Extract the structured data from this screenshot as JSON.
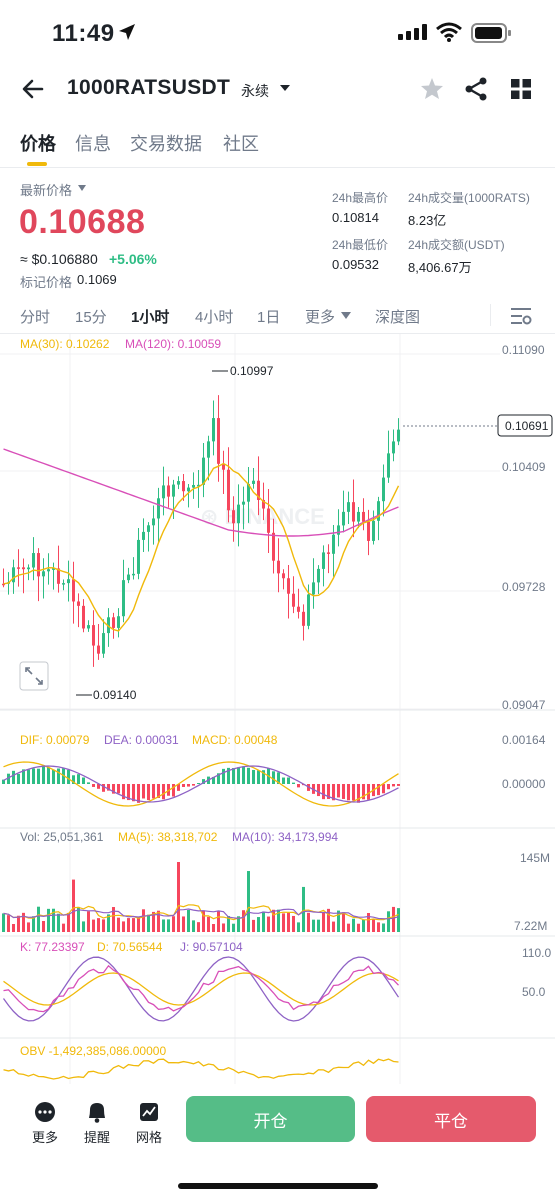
{
  "status_bar": {
    "time": "11:49"
  },
  "header": {
    "symbol": "1000RATSUSDT",
    "contract_type": "永续"
  },
  "tabs": [
    {
      "label": "价格",
      "active": true
    },
    {
      "label": "信息",
      "active": false
    },
    {
      "label": "交易数据",
      "active": false
    },
    {
      "label": "社区",
      "active": false
    }
  ],
  "price": {
    "label": "最新价格",
    "last": "0.10688",
    "usd": "≈ $0.106880",
    "change": "+5.06%",
    "mark_label": "标记价格",
    "mark_value": "0.1069"
  },
  "stats": {
    "high_label": "24h最高价",
    "high": "0.10814",
    "vol_label": "24h成交量(1000RATS)",
    "vol": "8.23亿",
    "low_label": "24h最低价",
    "low": "0.09532",
    "turnover_label": "24h成交额(USDT)",
    "turnover": "8,406.67万"
  },
  "timeframes": [
    {
      "label": "分时",
      "active": false
    },
    {
      "label": "15分",
      "active": false
    },
    {
      "label": "1小时",
      "active": true
    },
    {
      "label": "4小时",
      "active": false
    },
    {
      "label": "1日",
      "active": false
    },
    {
      "label": "更多",
      "active": false
    },
    {
      "label": "深度图",
      "active": false
    }
  ],
  "chart": {
    "ma30_label": "MA(30): 0.10262",
    "ma120_label": "MA(120): 0.10059",
    "y_ticks": [
      "0.11090",
      "0.10409",
      "0.09728",
      "0.09047"
    ],
    "current_price_tag": "0.10691",
    "high_marker": "0.10997",
    "low_marker": "0.09140",
    "macd": {
      "dif": "DIF: 0.00079",
      "dea": "DEA: 0.00031",
      "macd": "MACD: 0.00048",
      "y_ticks": [
        "0.00164",
        "0.00000"
      ]
    },
    "volume": {
      "vol": "Vol: 25,051,361",
      "ma5": "MA(5): 38,318,702",
      "ma10": "MA(10): 34,173,994",
      "y_ticks": [
        "145M",
        "7.22M"
      ]
    },
    "kdj": {
      "k": "K: 77.23397",
      "d": "D: 70.56544",
      "j": "J: 90.57104",
      "y_ticks": [
        "110.0",
        "50.0"
      ]
    },
    "obv": {
      "label": "OBV -1,492,385,086.00000"
    },
    "colors": {
      "up": "#2ebd85",
      "down": "#f6465d",
      "ma30": "#f0b90b",
      "ma120": "#d84fb8"
    }
  },
  "bottom": {
    "more": "更多",
    "alert": "提醒",
    "grid": "网格",
    "open": "开仓",
    "close": "平仓"
  }
}
